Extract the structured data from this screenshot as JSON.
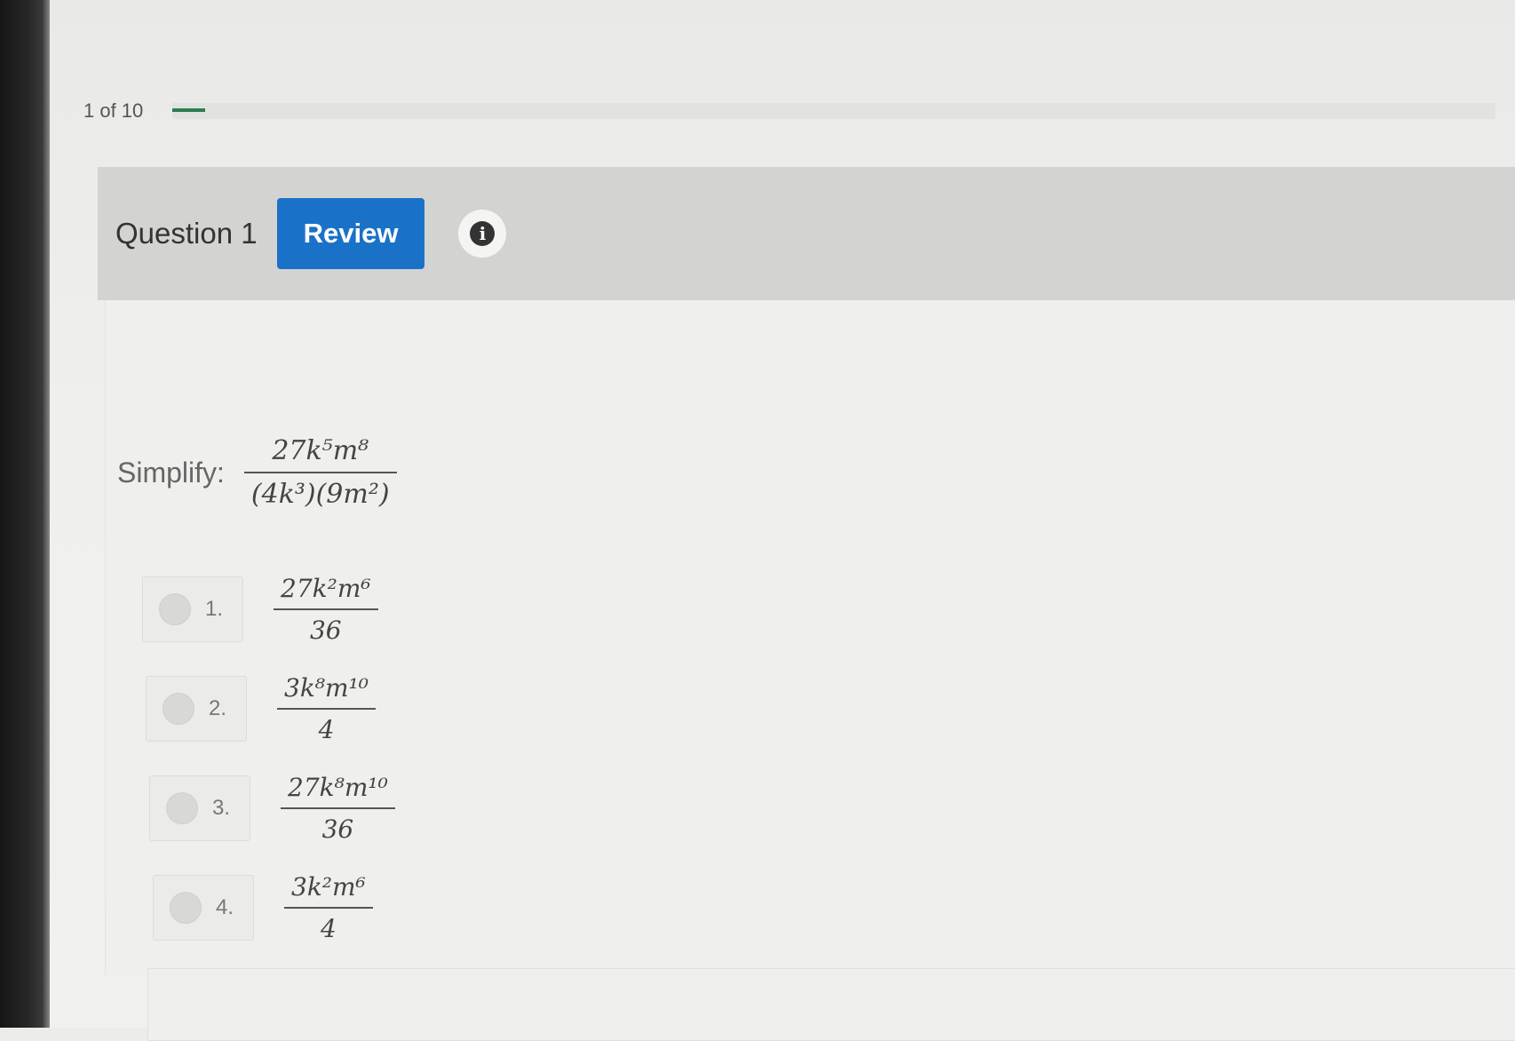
{
  "progress": {
    "text": "1 of 10",
    "value": 0.1
  },
  "question": {
    "label": "Question 1",
    "review_label": "Review",
    "info_glyph": "i",
    "stem_label": "Simplify:",
    "numerator": "27k⁵m⁸",
    "denominator": "(4k³)(9m²)"
  },
  "options": [
    {
      "number": "1.",
      "numerator": "27k²m⁶",
      "denominator": "36"
    },
    {
      "number": "2.",
      "numerator": "3k⁸m¹⁰",
      "denominator": "4"
    },
    {
      "number": "3.",
      "numerator": "27k⁸m¹⁰",
      "denominator": "36"
    },
    {
      "number": "4.",
      "numerator": "3k²m⁶",
      "denominator": "4"
    }
  ],
  "colors": {
    "accent": "#1a72c8",
    "progress": "#2e7d4f"
  },
  "icons": {
    "info": "info-icon"
  }
}
